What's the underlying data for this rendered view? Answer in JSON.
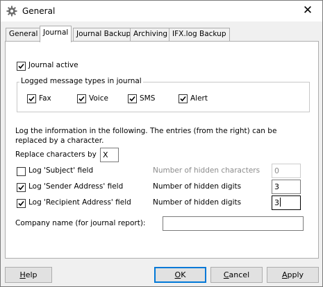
{
  "window": {
    "title": "General",
    "close_glyph": "✕"
  },
  "tabs": [
    {
      "label": "General",
      "active": false
    },
    {
      "label": "Journal",
      "active": true
    },
    {
      "label": "Journal Backup",
      "active": false
    },
    {
      "label": "Archiving",
      "active": false
    },
    {
      "label": "IFX.log Backup",
      "active": false
    }
  ],
  "journal": {
    "journal_active": {
      "label": "Journal active",
      "checked": true
    },
    "logged_types": {
      "title": "Logged message types in journal",
      "items": [
        {
          "label": "Fax",
          "checked": true
        },
        {
          "label": "Voice",
          "checked": true
        },
        {
          "label": "SMS",
          "checked": true
        },
        {
          "label": "Alert",
          "checked": true
        }
      ]
    },
    "info_line1": "Log the information in the following. The entries (from the right) can be",
    "info_line2": "replaced by a character.",
    "replace": {
      "label": "Replace characters by",
      "value": "X"
    },
    "fields": [
      {
        "label": "Log 'Subject' field",
        "checked": false,
        "count_label": "Number of hidden characters",
        "count_value": "0",
        "enabled": false
      },
      {
        "label": "Log 'Sender Address' field",
        "checked": true,
        "count_label": "Number of hidden digits",
        "count_value": "3",
        "enabled": true
      },
      {
        "label": "Log 'Recipient Address' field",
        "checked": true,
        "count_label": "Number of hidden digits",
        "count_value": "3",
        "enabled": true
      }
    ],
    "company": {
      "label": "Company name (for journal report):",
      "value": ""
    }
  },
  "buttons": {
    "help": {
      "pre": "",
      "hot": "H",
      "post": "elp"
    },
    "ok": {
      "pre": "",
      "hot": "O",
      "post": "K"
    },
    "cancel": {
      "pre": "",
      "hot": "C",
      "post": "ancel"
    },
    "apply": {
      "pre": "",
      "hot": "A",
      "post": "pply"
    }
  },
  "colors": {
    "accent": "#0078d7",
    "panel": "#ffffff",
    "window": "#f0f0f0"
  }
}
